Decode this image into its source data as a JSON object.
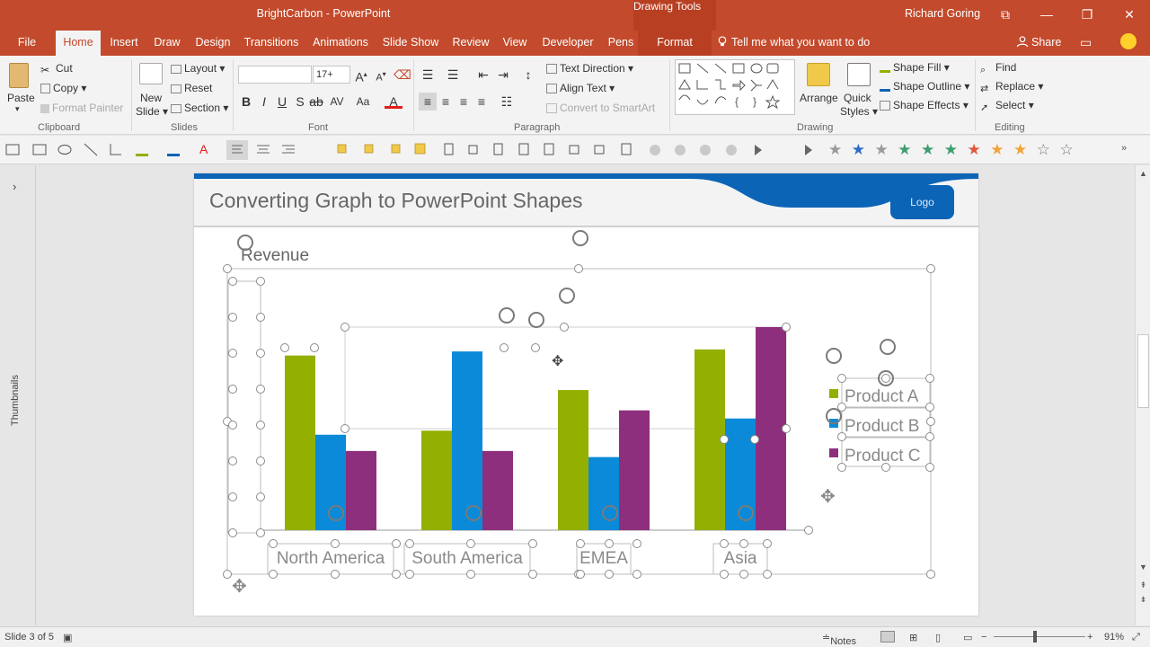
{
  "app": {
    "window_title": "BrightCarbon - PowerPoint",
    "context_tab_group": "Drawing Tools",
    "user_name": "Richard Goring",
    "accent_color": "#c34a2c"
  },
  "tabs": [
    {
      "label": "File"
    },
    {
      "label": "Home",
      "active": true
    },
    {
      "label": "Insert"
    },
    {
      "label": "Draw"
    },
    {
      "label": "Design"
    },
    {
      "label": "Transitions"
    },
    {
      "label": "Animations"
    },
    {
      "label": "Slide Show"
    },
    {
      "label": "Review"
    },
    {
      "label": "View"
    },
    {
      "label": "Developer"
    },
    {
      "label": "Pens"
    },
    {
      "label": "Format"
    }
  ],
  "tell_me": "Tell me what you want to do",
  "share_label": "Share",
  "ribbon": {
    "clipboard": {
      "paste": "Paste",
      "cut": "Cut",
      "copy": "Copy",
      "format_painter": "Format Painter",
      "group": "Clipboard"
    },
    "slides": {
      "new_slide": "New",
      "new_slide2": "Slide",
      "layout": "Layout",
      "reset": "Reset",
      "section": "Section",
      "group": "Slides"
    },
    "font": {
      "font_name": "",
      "font_size": "17+",
      "group": "Font"
    },
    "paragraph": {
      "text_direction": "Text Direction",
      "align_text": "Align Text",
      "smartart": "Convert to SmartArt",
      "group": "Paragraph"
    },
    "drawing": {
      "arrange": "Arrange",
      "quick_styles": "Quick",
      "quick_styles2": "Styles",
      "shape_fill": "Shape Fill",
      "shape_outline": "Shape Outline",
      "shape_effects": "Shape Effects",
      "group": "Drawing"
    },
    "editing": {
      "find": "Find",
      "replace": "Replace",
      "select": "Select",
      "group": "Editing"
    }
  },
  "thumbnails_label": "Thumbnails",
  "slide": {
    "title": "Converting Graph to PowerPoint Shapes",
    "logo_text": "Logo"
  },
  "chart_data": {
    "type": "bar",
    "title": "Revenue",
    "categories": [
      "North America",
      "South America",
      "EMEA",
      "Asia"
    ],
    "series": [
      {
        "name": "Product A",
        "color": "#93b000",
        "values": [
          86,
          49,
          69,
          89
        ]
      },
      {
        "name": "Product B",
        "color": "#0a8ad8",
        "values": [
          47,
          88,
          36,
          55
        ]
      },
      {
        "name": "Product C",
        "color": "#8e2f7e",
        "values": [
          39,
          39,
          59,
          100
        ]
      }
    ],
    "ylim": [
      0,
      100
    ],
    "legend_position": "right"
  },
  "status": {
    "slide_info": "Slide 3 of 5",
    "notes": "Notes",
    "zoom": "91%"
  }
}
